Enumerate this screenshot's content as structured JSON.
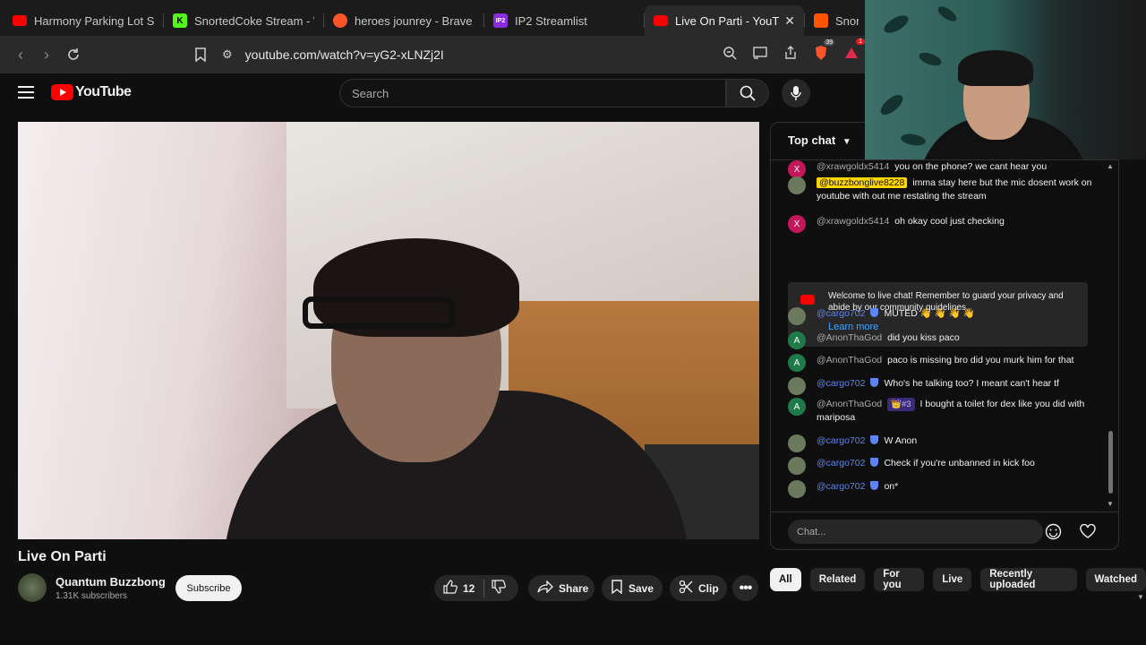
{
  "tabs": [
    {
      "title": "Harmony Parking Lot So",
      "fav": "yt",
      "active": false
    },
    {
      "title": "SnortedCoke Stream - W",
      "fav": "k",
      "active": false
    },
    {
      "title": "heroes jounrey - Brave S",
      "fav": "brave",
      "active": false
    },
    {
      "title": "IP2 Streamlist",
      "fav": "ip2",
      "active": false
    },
    {
      "title": "Live On Parti - YouT",
      "fav": "yt",
      "active": true
    },
    {
      "title": "Snorte",
      "fav": "sc",
      "active": false
    }
  ],
  "tab_close": "✕",
  "address": {
    "url": "youtube.com/watch?v=yG2-xLNZj2I"
  },
  "brave_badge": "39",
  "notif_badge": "1",
  "header": {
    "logo_text": "YouTube",
    "search_placeholder": "Search"
  },
  "video": {
    "title": "Live On Parti",
    "channel": "Quantum Buzzbong",
    "subscribers": "1.31K subscribers",
    "subscribe_label": "Subscribe",
    "like_count": "12",
    "share_label": "Share",
    "save_label": "Save",
    "clip_label": "Clip"
  },
  "chat": {
    "header_label": "Top chat",
    "welcome_text": "Welcome to live chat! Remember to guard your privacy and abide by our community guidelines.",
    "learn_more": "Learn more",
    "input_placeholder": "Chat...",
    "messages": [
      {
        "avatar": "X",
        "avatar_color": "#c2185b",
        "author": "@xrawgoldx5414",
        "style": "normal",
        "text": "you on the phone? we cant hear you"
      },
      {
        "avatar": "",
        "avatar_color": "#6b7a5c",
        "author": "@buzzbonglive8228",
        "style": "owner",
        "text": "imma stay here but the mic dosent work on youtube with out me restating the stream"
      },
      {
        "avatar": "X",
        "avatar_color": "#c2185b",
        "author": "@xrawgoldx5414",
        "style": "normal",
        "text": "oh okay cool just checking"
      },
      {
        "avatar": "",
        "avatar_color": "#6b7a5c",
        "author": "@cargo702",
        "style": "mod",
        "text": "MUTED 👋 👋 👋 👋"
      },
      {
        "avatar": "A",
        "avatar_color": "#1f7a4a",
        "author": "@AnonThaGod",
        "style": "normal",
        "text": "did you kiss paco"
      },
      {
        "avatar": "A",
        "avatar_color": "#1f7a4a",
        "author": "@AnonThaGod",
        "style": "normal",
        "text": "paco is missing bro did you murk him for that"
      },
      {
        "avatar": "",
        "avatar_color": "#6b7a5c",
        "author": "@cargo702",
        "style": "mod",
        "text": "Who's he talking too? I meant can't hear tf"
      },
      {
        "avatar": "A",
        "avatar_color": "#1f7a4a",
        "author": "@AnonThaGod",
        "style": "normal",
        "badge": "👑#3",
        "text": "I bought a toilet for dex like you did with mariposa"
      },
      {
        "avatar": "",
        "avatar_color": "#6b7a5c",
        "author": "@cargo702",
        "style": "mod",
        "text": "W Anon"
      },
      {
        "avatar": "",
        "avatar_color": "#6b7a5c",
        "author": "@cargo702",
        "style": "mod",
        "text": "Check if you're unbanned in kick foo"
      },
      {
        "avatar": "",
        "avatar_color": "#6b7a5c",
        "author": "@cargo702",
        "style": "mod",
        "text": "on*"
      }
    ]
  },
  "chips": [
    "All",
    "Related",
    "For you",
    "Live",
    "Recently uploaded",
    "Watched"
  ]
}
